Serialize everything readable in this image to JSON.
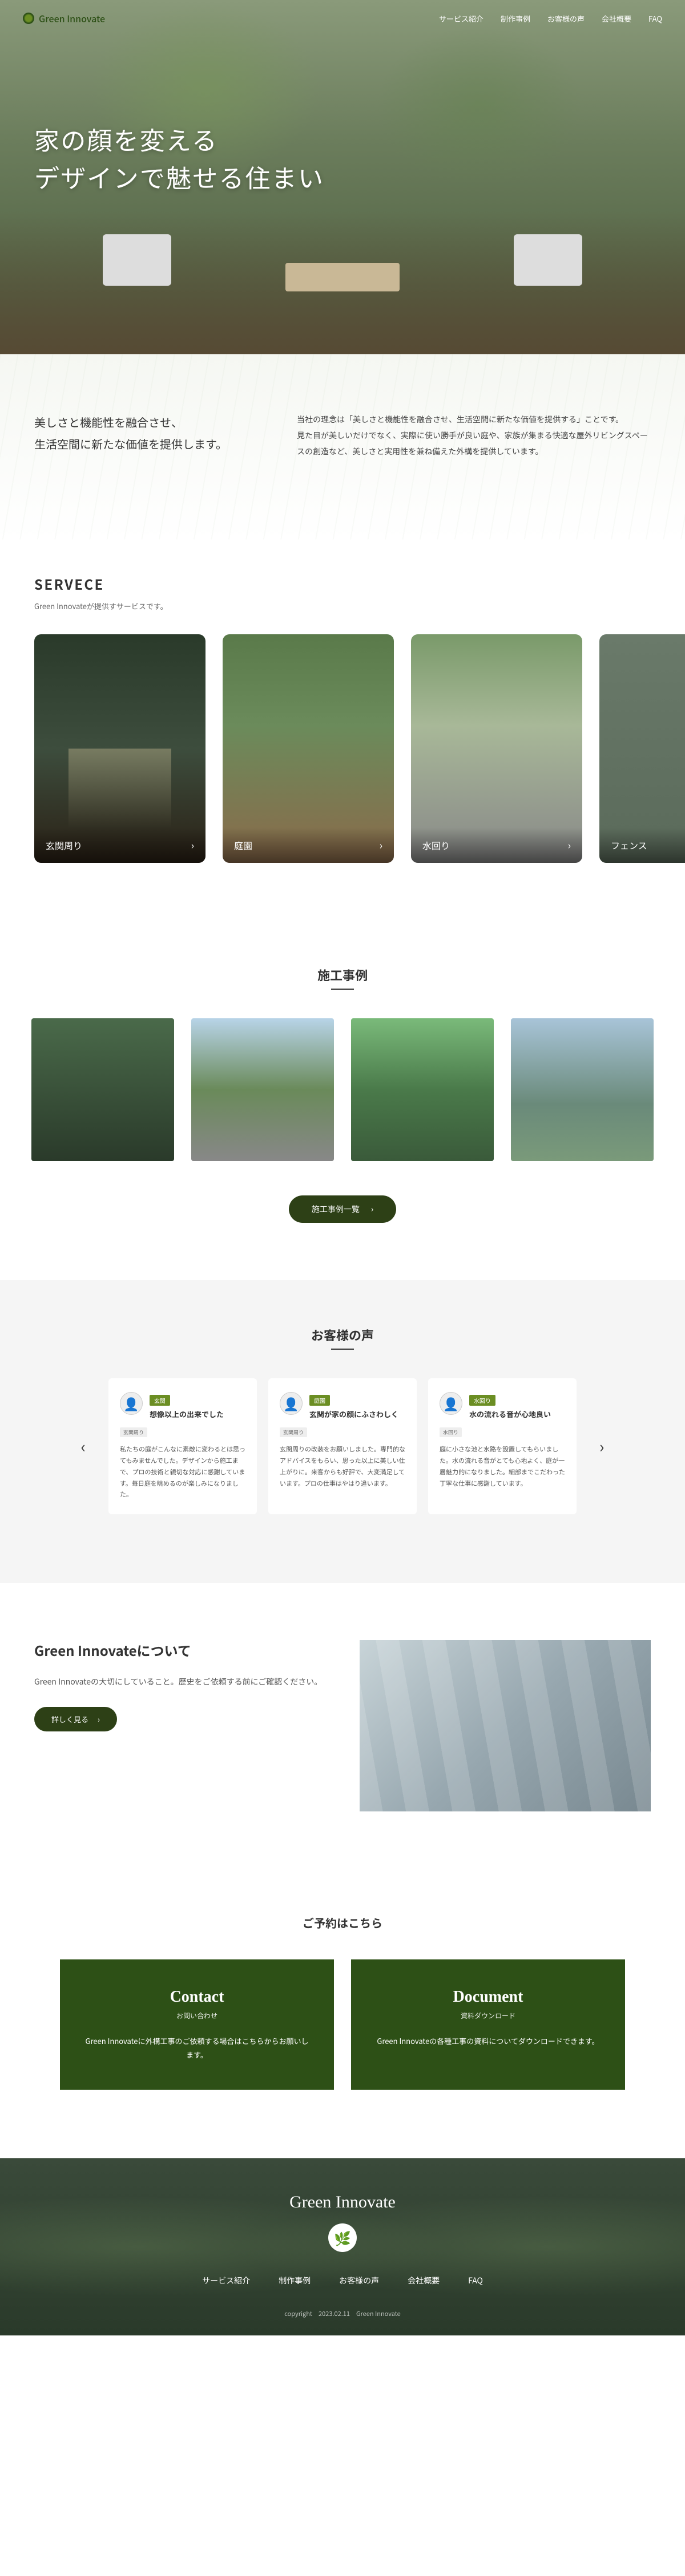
{
  "brand": "Green Innovate",
  "nav": {
    "items": [
      {
        "label": "サービス紹介"
      },
      {
        "label": "制作事例"
      },
      {
        "label": "お客様の声"
      },
      {
        "label": "会社概要"
      },
      {
        "label": "FAQ"
      }
    ]
  },
  "hero": {
    "line1": "家の顔を変える",
    "line2": "デザインで魅せる住まい"
  },
  "intro": {
    "left_line1": "美しさと機能性を融合させ、",
    "left_line2": "生活空間に新たな価値を提供します。",
    "right": "当社の理念は「美しさと機能性を融合させ、生活空間に新たな価値を提供する」ことです。\n見た目が美しいだけでなく、実際に使い勝手が良い庭や、家族が集まる快適な屋外リビングスペースの創造など、美しさと実用性を兼ね備えた外構を提供しています。"
  },
  "service": {
    "heading": "SERVECE",
    "sub": "Green Innovateが提供すサービスです。",
    "cards": [
      {
        "label": "玄関周り"
      },
      {
        "label": "庭園"
      },
      {
        "label": "水回り"
      },
      {
        "label": "フェンス"
      }
    ]
  },
  "works": {
    "heading": "施工事例",
    "button": "施工事例一覧"
  },
  "voice": {
    "heading": "お客様の声",
    "cards": [
      {
        "chip": "玄関",
        "title": "想像以上の出来でした",
        "tags": [
          "玄関周り"
        ],
        "body": "私たちの庭がこんなに素敵に変わるとは思ってもみませんでした。デザインから施工まで、プロの技術と親切な対応に感謝しています。毎日庭を眺めるのが楽しみになりました。"
      },
      {
        "chip": "庭園",
        "title": "玄関が家の顔にふさわしく",
        "tags": [
          "玄関周り"
        ],
        "body": "玄関周りの改装をお願いしました。専門的なアドバイスをもらい、思った以上に美しい仕上がりに。来客からも好評で、大変満足しています。プロの仕事はやはり違います。"
      },
      {
        "chip": "水回り",
        "title": "水の流れる音が心地良い",
        "tags": [
          "水回り"
        ],
        "body": "庭に小さな池と水路を設置してもらいました。水の流れる音がとても心地よく、庭が一層魅力的になりました。細部までこだわった丁寧な仕事に感謝しています。"
      }
    ]
  },
  "about": {
    "heading": "Green Innovateについて",
    "body": "Green Innovateの大切にしていること。歴史をご依頼する前にご確認ください。",
    "button": "詳しく見る"
  },
  "reserve": {
    "heading": "ご予約はこちら",
    "cards": [
      {
        "title": "Contact",
        "sub": "お問い合わせ",
        "body": "Green Innovateに外構工事のご依頼する場合はこちらからお願いします。"
      },
      {
        "title": "Document",
        "sub": "資料ダウンロード",
        "body": "Green Innovateの各種工事の資料についてダウンロードできます。"
      }
    ]
  },
  "footer": {
    "brand": "Green Innovate",
    "nav": [
      {
        "label": "サービス紹介"
      },
      {
        "label": "制作事例"
      },
      {
        "label": "お客様の声"
      },
      {
        "label": "会社概要"
      },
      {
        "label": "FAQ"
      }
    ],
    "copyright": "copyright　2023.02.11　Green Innovate"
  }
}
